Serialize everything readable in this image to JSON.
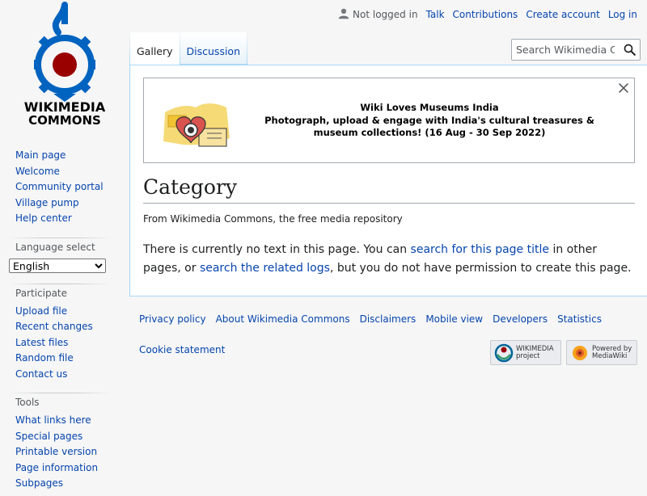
{
  "logo": {
    "line1": "WIKIMEDIA",
    "line2": "COMMONS",
    "color": "#0063bf",
    "accent": "#990000"
  },
  "personal_tools": {
    "not_logged_in": "Not logged in",
    "talk": "Talk",
    "contributions": "Contributions",
    "create_account": "Create account",
    "log_in": "Log in"
  },
  "tabs": [
    {
      "label": "Gallery",
      "selected": true
    },
    {
      "label": "Discussion",
      "selected": false
    }
  ],
  "search": {
    "placeholder": "Search Wikimedia Commons"
  },
  "banner": {
    "title": "Wiki Loves Museums India",
    "body": "Photograph, upload & engage with India's cultural treasures & museum collections! (16 Aug - 30 Sep 2022)"
  },
  "page": {
    "heading": "Category",
    "site_sub": "From Wikimedia Commons, the free media repository",
    "notext_before": "There is currently no text in this page. You can ",
    "notext_link1": "search for this page title",
    "notext_middle": " in other pages, or ",
    "notext_link2": "search the related logs",
    "notext_after": ", but you do not have permission to create this page."
  },
  "sidebar": {
    "navigation": [
      "Main page",
      "Welcome",
      "Community portal",
      "Village pump",
      "Help center"
    ],
    "language": {
      "heading": "Language select",
      "selected": "English"
    },
    "participate": {
      "heading": "Participate",
      "items": [
        "Upload file",
        "Recent changes",
        "Latest files",
        "Random file",
        "Contact us"
      ]
    },
    "tools": {
      "heading": "Tools",
      "items": [
        "What links here",
        "Special pages",
        "Printable version",
        "Page information",
        "Subpages"
      ]
    }
  },
  "footer": {
    "places": [
      "Privacy policy",
      "About Wikimedia Commons",
      "Disclaimers",
      "Mobile view",
      "Developers",
      "Statistics"
    ],
    "cookie": "Cookie statement",
    "wikimedia_badge": {
      "line1": "WIKIMEDIA",
      "line2": "project"
    },
    "mediawiki_badge": {
      "line1": "Powered by",
      "line2": "MediaWiki"
    }
  }
}
